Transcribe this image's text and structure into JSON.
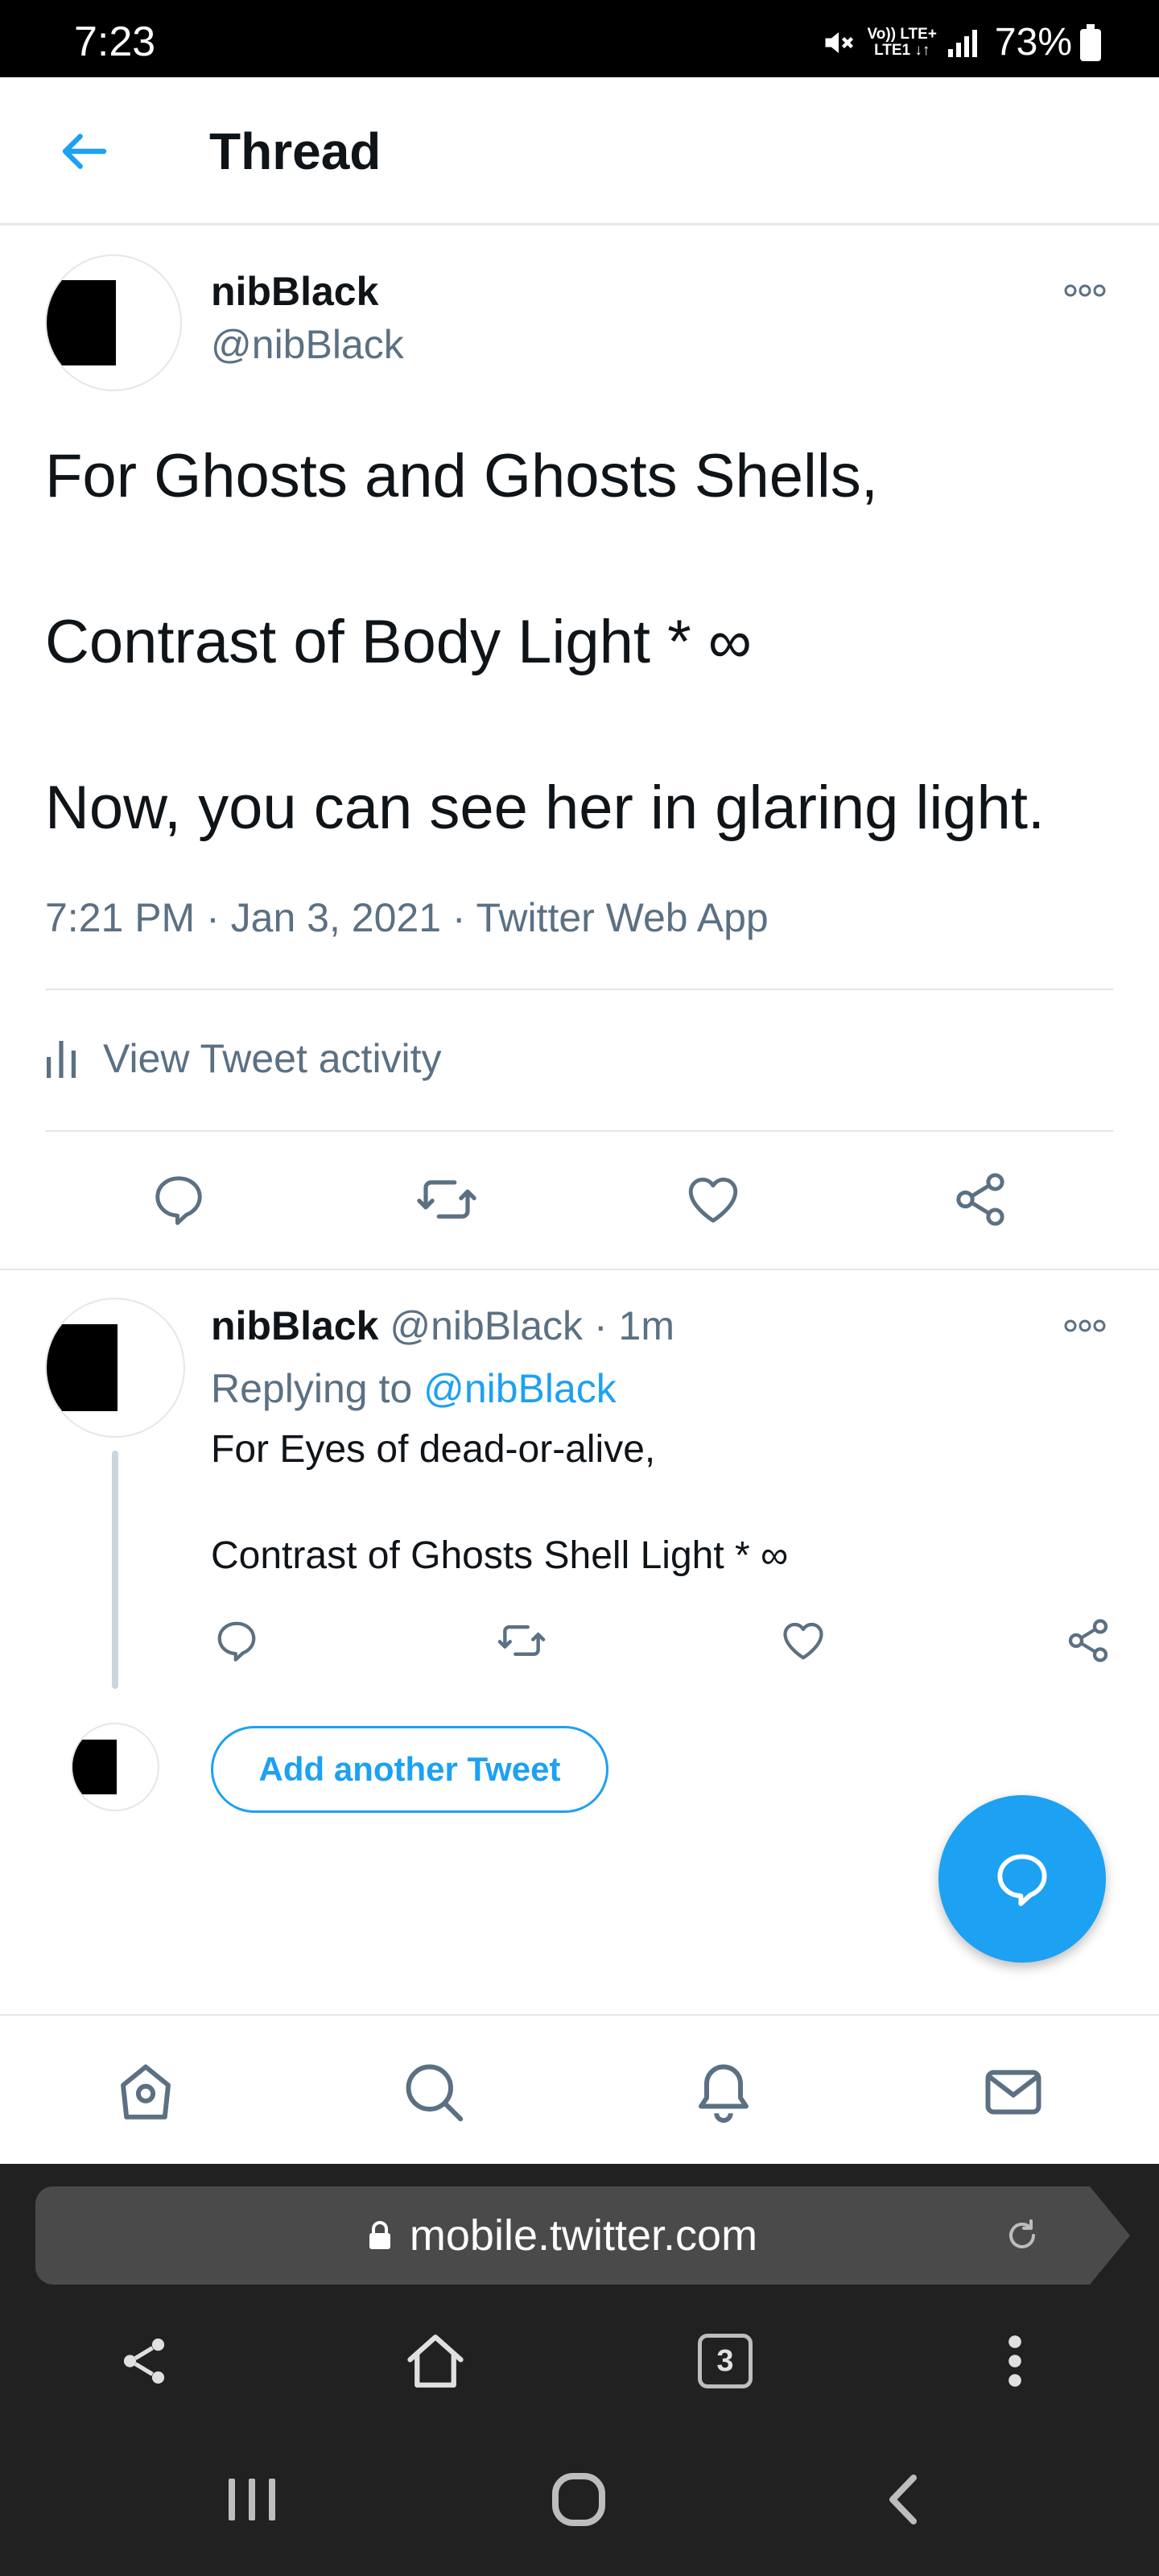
{
  "status_bar": {
    "time": "7:23",
    "network_line1": "Vo)) LTE+",
    "network_line2": "LTE1 ↓↑",
    "battery_percent": "73%",
    "icons": [
      "mute-icon",
      "signal-icon",
      "battery-icon"
    ]
  },
  "header": {
    "title": "Thread",
    "back_icon": "arrow-left-icon"
  },
  "main_tweet": {
    "name": "nibBlack",
    "handle": "@nibBlack",
    "lines": [
      "For Ghosts and Ghosts Shells,",
      "Contrast of Body Light * ∞",
      "Now, you can see her in glaring light."
    ],
    "time": "7:21 PM",
    "date": "Jan 3, 2021",
    "source": "Twitter Web App",
    "activity_label": "View Tweet activity"
  },
  "reply_tweet": {
    "name": "nibBlack",
    "handle": "@nibBlack",
    "age": "1m",
    "replying_prefix": "Replying to",
    "replying_handle": "@nibBlack",
    "lines": [
      "For Eyes of dead-or-alive,",
      "Contrast of Ghosts Shell Light * ∞"
    ]
  },
  "add_tweet_label": "Add another Tweet",
  "bottom_nav": [
    "home-icon",
    "search-icon",
    "notifications-icon",
    "messages-icon"
  ],
  "browser": {
    "url": "mobile.twitter.com",
    "tabs_count": "3"
  },
  "colors": {
    "accent": "#1da1f2",
    "text": "#0f1419",
    "muted": "#5b7083",
    "divider": "#e1e8ed",
    "browser_bg": "#212121"
  }
}
